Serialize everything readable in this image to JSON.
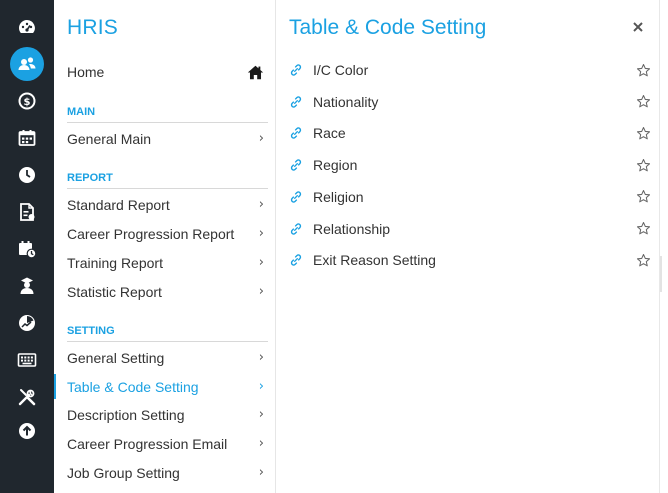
{
  "menu": {
    "title": "HRIS",
    "home_label": "Home",
    "sections": {
      "main": "MAIN",
      "report": "REPORT",
      "setting": "SETTING"
    },
    "items": {
      "general_main": "General Main",
      "standard_report": "Standard Report",
      "career_progression_report": "Career Progression Report",
      "training_report": "Training Report",
      "statistic_report": "Statistic Report",
      "general_setting": "General Setting",
      "table_code_setting": "Table & Code Setting",
      "description_setting": "Description Setting",
      "career_progression_email": "Career Progression Email",
      "job_group_setting": "Job Group Setting"
    },
    "chevron": "›",
    "active_item": "Table & Code Setting"
  },
  "content": {
    "title": "Table & Code Setting",
    "links": [
      {
        "label": "I/C Color"
      },
      {
        "label": "Nationality"
      },
      {
        "label": "Race"
      },
      {
        "label": "Region"
      },
      {
        "label": "Religion"
      },
      {
        "label": "Relationship"
      },
      {
        "label": "Exit Reason Setting"
      }
    ]
  },
  "rail_icons": [
    "dashboard-icon",
    "users-icon",
    "payroll-icon",
    "calendar-icon",
    "clock-icon",
    "document-icon",
    "schedule-icon",
    "person-icon",
    "chart-icon",
    "keyboard-icon",
    "tools-icon",
    "upload-icon"
  ],
  "colors": {
    "accent": "#1ba1e2",
    "rail_bg": "#20272e",
    "text": "#333333",
    "icon": "#ffffff"
  }
}
